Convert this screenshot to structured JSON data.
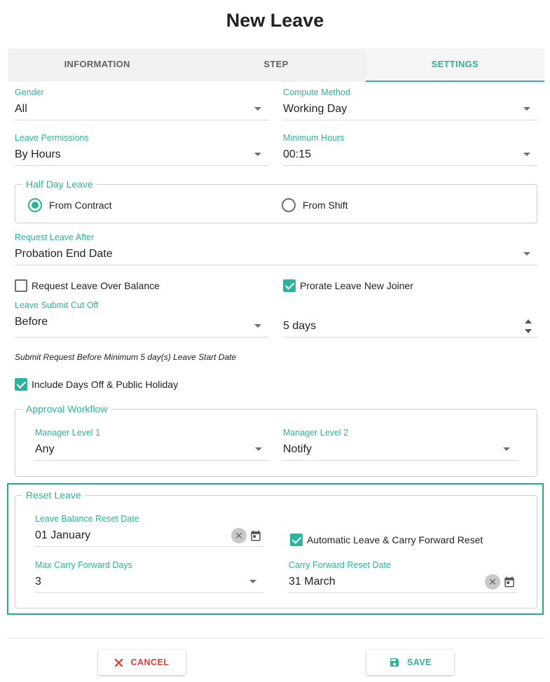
{
  "header": {
    "title": "New Leave"
  },
  "tabs": [
    {
      "label": "INFORMATION"
    },
    {
      "label": "STEP"
    },
    {
      "label": "SETTINGS"
    }
  ],
  "active_tab": "SETTINGS",
  "accent_color": "#2bb39b",
  "cancel_color": "#e53935",
  "form": {
    "gender": {
      "label": "Gender",
      "value": "All"
    },
    "compute_method": {
      "label": "Compute Method",
      "value": "Working Day"
    },
    "leave_permissions": {
      "label": "Leave Permissions",
      "value": "By Hours"
    },
    "minimum_hours": {
      "label": "Minimum Hours",
      "value": "00:15"
    },
    "half_day": {
      "legend": "Half Day Leave",
      "options": [
        {
          "label": "From Contract",
          "selected": true
        },
        {
          "label": "From Shift",
          "selected": false
        }
      ]
    },
    "request_leave_after": {
      "label": "Request Leave After",
      "value": "Probation End Date"
    },
    "request_over_balance": {
      "label": "Request Leave Over Balance",
      "checked": false
    },
    "prorate_new_joiner": {
      "label": "Prorate Leave New Joiner",
      "checked": true
    },
    "submit_cut_off": {
      "label": "Leave Submit Cut Off",
      "value": "Before",
      "days_value": "5 days"
    },
    "hint": "Submit Request Before Minimum 5 day(s) Leave Start Date",
    "include_days_off": {
      "label": "Include Days Off & Public Holiday",
      "checked": true
    },
    "approval": {
      "legend": "Approval Workflow",
      "manager_level_1": {
        "label": "Manager Level 1",
        "value": "Any"
      },
      "manager_level_2": {
        "label": "Manager Level 2",
        "value": "Notify"
      }
    },
    "reset": {
      "legend": "Reset Leave",
      "balance_reset_date": {
        "label": "Leave Balance Reset Date",
        "value": "01 January"
      },
      "auto_carry_forward": {
        "label": "Automatic Leave & Carry Forward Reset",
        "checked": true
      },
      "max_carry_forward_days": {
        "label": "Max Carry Forward Days",
        "value": "3"
      },
      "carry_forward_reset_date": {
        "label": "Carry Forward Reset Date",
        "value": "31 March"
      }
    }
  },
  "footer": {
    "cancel_label": "CANCEL",
    "save_label": "SAVE"
  },
  "icons": {
    "clear": "close-circle-icon",
    "calendar": "calendar-icon",
    "cancel": "close-icon",
    "save": "floppy-disk-icon"
  }
}
